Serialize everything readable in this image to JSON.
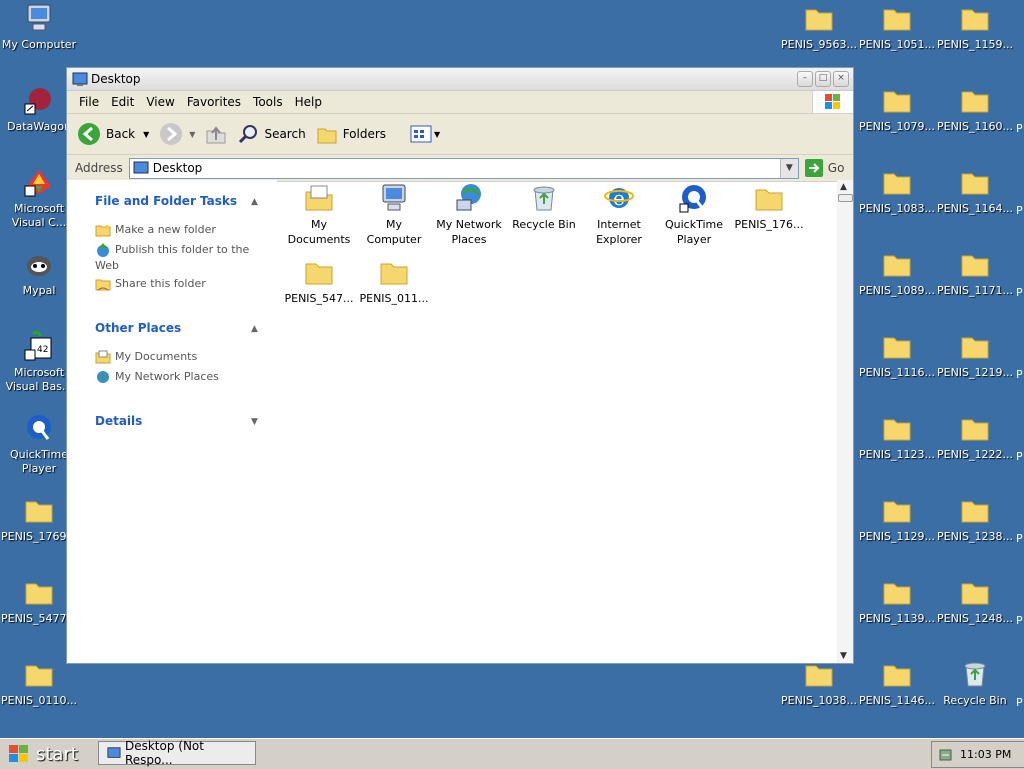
{
  "desktop": {
    "left_icons": [
      {
        "label": "My Computer",
        "icon": "my-computer-icon"
      },
      {
        "label": "DataWagon",
        "icon": "datawagon-icon"
      },
      {
        "label": "Microsoft Visual C...",
        "icon": "msvc-icon"
      },
      {
        "label": "Mypal",
        "icon": "mypal-icon"
      },
      {
        "label": "Microsoft Visual Bas...",
        "icon": "msvb-icon"
      },
      {
        "label": "QuickTime Player",
        "icon": "quicktime-icon"
      },
      {
        "label": "PENIS_1769...",
        "icon": "folder-icon"
      },
      {
        "label": "PENIS_5477...",
        "icon": "folder-icon"
      },
      {
        "label": "PENIS_0110...",
        "icon": "folder-icon"
      }
    ],
    "right_icons": [
      [
        "PENIS_9563...",
        "PENIS_1051...",
        "PENIS_1159..."
      ],
      [
        "",
        "PENIS_1079...",
        "PENIS_1160..."
      ],
      [
        "",
        "PENIS_1083...",
        "PENIS_1164..."
      ],
      [
        "",
        "PENIS_1089...",
        "PENIS_1171..."
      ],
      [
        "",
        "PENIS_1116...",
        "PENIS_1219..."
      ],
      [
        "",
        "PENIS_1123...",
        "PENIS_1222..."
      ],
      [
        "",
        "PENIS_1129...",
        "PENIS_1238..."
      ],
      [
        "",
        "PENIS_1139...",
        "PENIS_1248..."
      ],
      [
        "PENIS_1038...",
        "PENIS_1146...",
        "Recycle Bin"
      ]
    ],
    "edge_letter": "P"
  },
  "window": {
    "title": "Desktop",
    "menu": [
      "File",
      "Edit",
      "View",
      "Favorites",
      "Tools",
      "Help"
    ],
    "toolbar": {
      "back": "Back",
      "search": "Search",
      "folders": "Folders"
    },
    "address_label": "Address",
    "address_value": "Desktop",
    "go_label": "Go",
    "tasks": {
      "file_folder_title": "File and Folder Tasks",
      "file_folder_items": [
        "Make a new folder",
        "Publish this folder to the Web",
        "Share this folder"
      ],
      "other_places_title": "Other Places",
      "other_places_items": [
        "My Documents",
        "My Network Places"
      ],
      "details_title": "Details"
    },
    "files": [
      {
        "label": "My Documents",
        "icon": "my-documents-icon"
      },
      {
        "label": "My Computer",
        "icon": "my-computer-icon"
      },
      {
        "label": "My Network Places",
        "icon": "network-places-icon"
      },
      {
        "label": "Recycle Bin",
        "icon": "recycle-bin-icon"
      },
      {
        "label": "Internet Explorer",
        "icon": "internet-explorer-icon"
      },
      {
        "label": "QuickTime Player",
        "icon": "quicktime-icon"
      },
      {
        "label": "PENIS_176...",
        "icon": "folder-icon"
      },
      {
        "label": "PENIS_547...",
        "icon": "folder-icon"
      },
      {
        "label": "PENIS_011...",
        "icon": "folder-icon"
      }
    ]
  },
  "taskbar": {
    "start_label": "start",
    "task_label": "Desktop (Not Respo...",
    "clock": "11:03 PM"
  },
  "colors": {
    "desktop": "#3a6ea5",
    "link_blue": "#215dc6",
    "folder": "#f5d76e"
  }
}
